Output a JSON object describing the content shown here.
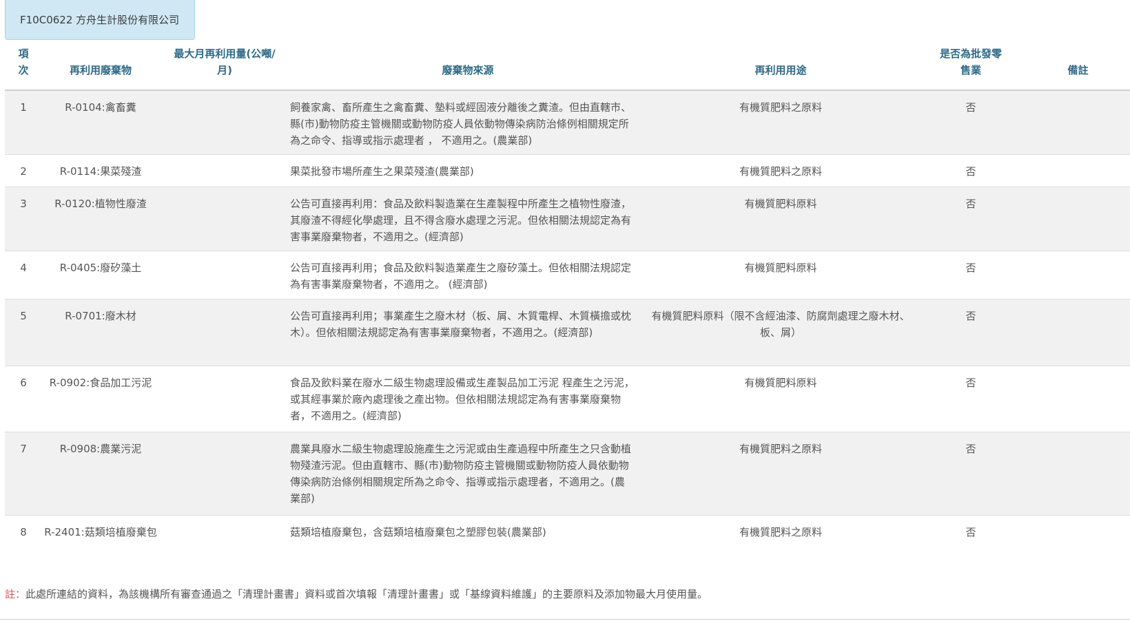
{
  "company": {
    "label": "F10C0622 方舟生計股份有限公司"
  },
  "table": {
    "headers": {
      "no": "項\n次",
      "item": "再利用廢棄物",
      "max_usage": "最大月再利用量(公噸/\n月)",
      "source": "廢棄物來源",
      "usage": "再利用用途",
      "bulk": "是否為批發零\n售業",
      "note": "備註"
    },
    "rows": [
      {
        "no": "1",
        "item": "R-0104:禽畜糞",
        "max_usage": "",
        "source": "飼養家禽、畜所產生之禽畜糞、墊料或經固液分離後之糞渣。但由直轄市、縣(市)動物防疫主管機關或動物防疫人員依動物傳染病防治條例相關規定所為之命令、指導或指示處理者 ， 不適用之。(農業部)",
        "usage": "有機質肥料之原料",
        "bulk": "否",
        "note": ""
      },
      {
        "no": "2",
        "item": "R-0114:果菜殘渣",
        "max_usage": "",
        "source": "果菜批發市場所產生之果菜殘渣(農業部)",
        "usage": "有機質肥料之原料",
        "bulk": "否",
        "note": ""
      },
      {
        "no": "3",
        "item": "R-0120:植物性廢渣",
        "max_usage": "",
        "source": "公告可直接再利用：食品及飲料製造業在生產製程中所產生之植物性廢渣，其廢渣不得經化學處理，且不得含廢水處理之污泥。但依相關法規認定為有害事業廢棄物者，不適用之。(經濟部)",
        "usage": "有機質肥料原料",
        "bulk": "否",
        "note": ""
      },
      {
        "no": "4",
        "item": "R-0405:廢矽藻土",
        "max_usage": "",
        "source": "公告可直接再利用；食品及飲料製造業產生之廢矽藻土。但依相關法規認定為有害事業廢棄物者，不適用之。 (經濟部)",
        "usage": "有機質肥料原料",
        "bulk": "否",
        "note": ""
      },
      {
        "no": "5",
        "item": "R-0701:廢木材",
        "max_usage": "",
        "source": "公告可直接再利用；事業產生之廢木材（板、屑、木質電桿、木質橫擔或枕木）。但依相關法規認定為有害事業廢棄物者，不適用之。(經濟部)",
        "usage": "有機質肥料原料（限不含經油漆、防腐劑處理之廢木材、板、屑）",
        "bulk": "否",
        "note": ""
      },
      {
        "no": "6",
        "item": "R-0902:食品加工污泥",
        "max_usage": "",
        "source": "食品及飲料業在廢水二級生物處理設備或生產製品加工污泥 程產生之污泥，或其經事業於廠內處理後之產出物。但依相關法規認定為有害事業廢棄物者，不適用之。(經濟部)",
        "usage": "有機質肥料原料",
        "bulk": "否",
        "note": ""
      },
      {
        "no": "7",
        "item": "R-0908:農業污泥",
        "max_usage": "",
        "source": "農業具廢水二級生物處理設施產生之污泥或由生產過程中所產生之只含動植物殘渣污泥。但由直轄市、縣(市)動物防疫主管機關或動物防疫人員依動物傳染病防治條例相關規定所為之命令、指導或指示處理者，不適用之。(農業部)",
        "usage": "有機質肥料之原料",
        "bulk": "否",
        "note": ""
      },
      {
        "no": "8",
        "item": "R-2401:菇類培植廢棄包",
        "max_usage": "",
        "source": "菇類培植廢棄包，含菇類培植廢棄包之塑膠包裝(農業部)",
        "usage": "有機質肥料之原料",
        "bulk": "否",
        "note": ""
      }
    ]
  },
  "footnote": {
    "mark": "註：",
    "text": "此處所連結的資料，為該機構所有審查通過之「清理計畫書」資料或首次填報「清理計畫書」或「基線資料維護」的主要原料及添加物最大月使用量。"
  }
}
